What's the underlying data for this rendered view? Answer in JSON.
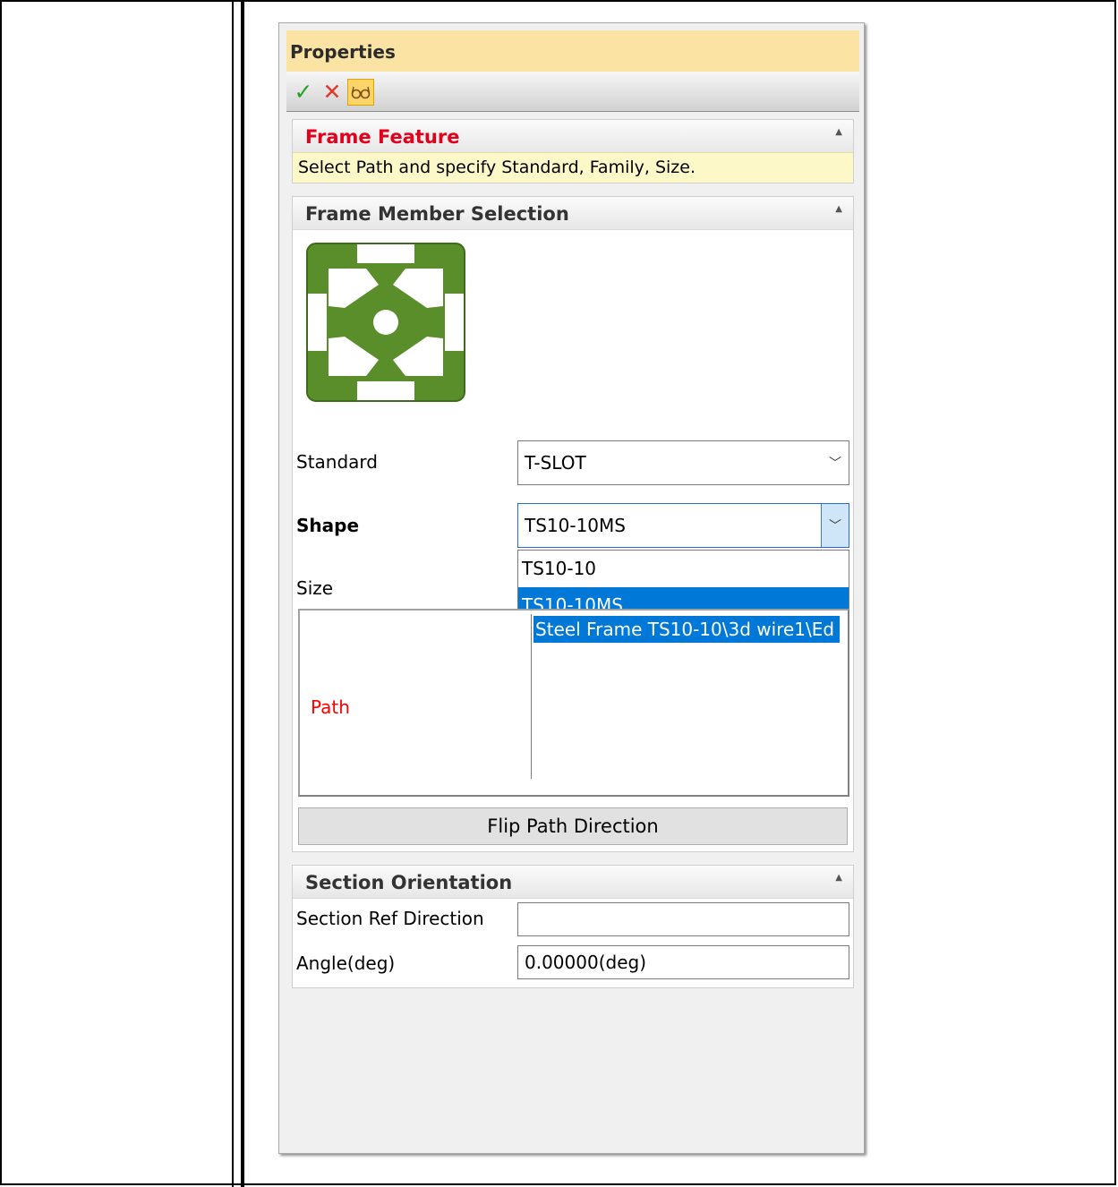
{
  "panel": {
    "title": "Properties",
    "toolbar": {
      "ok_icon": "check-icon",
      "cancel_icon": "close-icon",
      "detail_icon": "glasses-icon"
    }
  },
  "frame_feature": {
    "title": "Frame Feature",
    "hint": "Select Path and specify Standard, Family, Size."
  },
  "member_selection": {
    "title": "Frame Member Selection",
    "preview_color": "#5a8e2a",
    "standard_label": "Standard",
    "standard_value": "T-SLOT",
    "shape_label": "Shape",
    "shape_value": "TS10-10MS",
    "shape_options": [
      "TS10-10",
      "TS10-10MS"
    ],
    "shape_selected": "TS10-10MS",
    "size_label": "Size",
    "path_label": "Path",
    "path_items": [
      "Steel Frame TS10-10\\3d wire1\\Ed"
    ],
    "flip_button": "Flip Path Direction"
  },
  "section_orientation": {
    "title": "Section Orientation",
    "ref_direction_label": "Section Ref Direction",
    "ref_direction_value": "",
    "angle_label": "Angle(deg)",
    "angle_value": "0.00000(deg)"
  },
  "colors": {
    "header_bg": "#fbe3a3",
    "accent_red": "#ff0000",
    "selection_blue": "#0078d7"
  }
}
